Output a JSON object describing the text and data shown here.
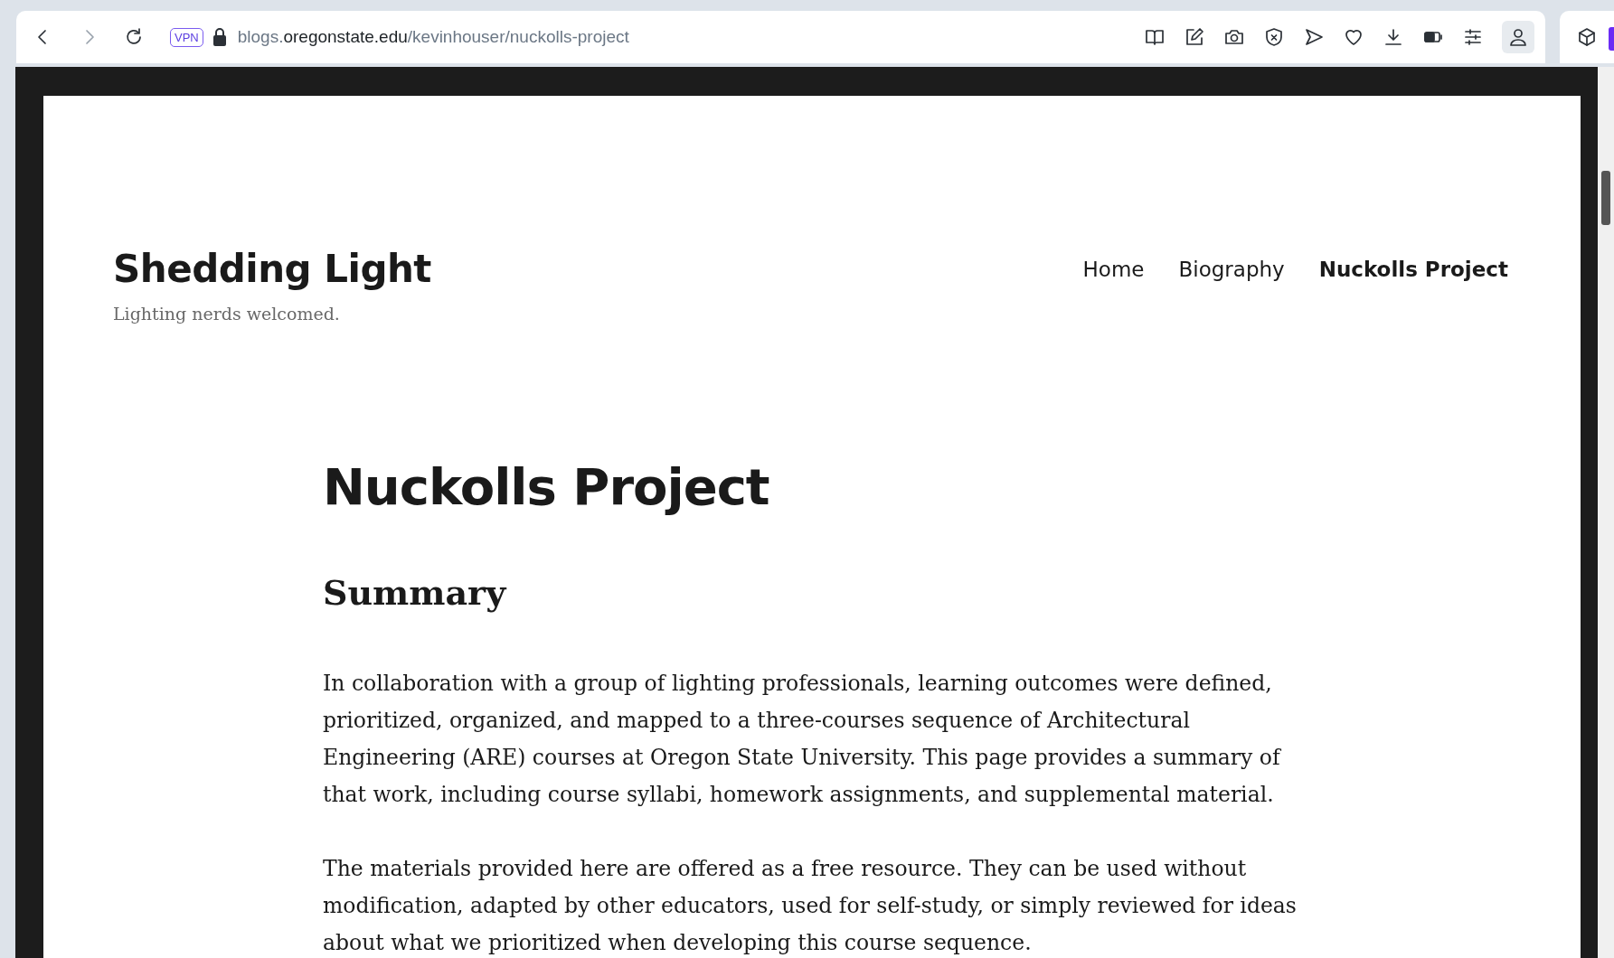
{
  "browser": {
    "vpn_badge": "VPN",
    "url": {
      "subdomain": "blogs.",
      "domain": "oregonstate.edu",
      "path": "/kevinhouser/nuckolls-project"
    }
  },
  "site": {
    "title": "Shedding Light",
    "tagline": "Lighting nerds welcomed."
  },
  "nav": [
    {
      "label": "Home",
      "selected": false
    },
    {
      "label": "Biography",
      "selected": false
    },
    {
      "label": "Nuckolls Project",
      "selected": true
    }
  ],
  "article": {
    "title": "Nuckolls Project",
    "heading": "Summary",
    "paragraphs": [
      "In collaboration with a group of lighting professionals, learning outcomes were defined, prioritized, organized, and mapped to a three-courses sequence of Architectural Engineering (ARE) courses at Oregon State University. This page provides a summary of that work, including course syllabi, homework assignments, and supplemental material.",
      "The materials provided here are offered as a free resource. They can be used without modification, adapted by other educators, used for self-study, or simply reviewed for ideas about what we prioritized when developing this course sequence."
    ]
  }
}
